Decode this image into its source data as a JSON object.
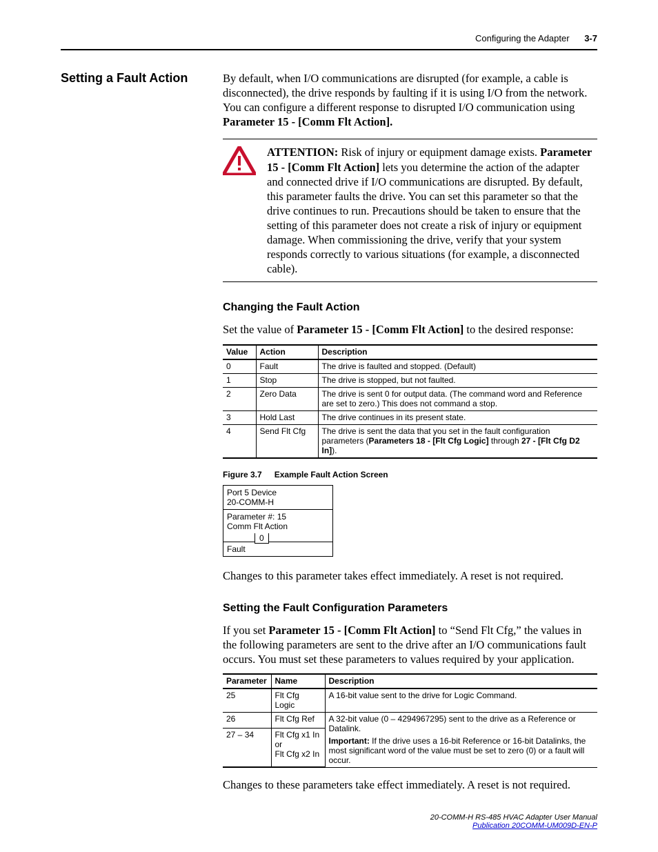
{
  "header": {
    "chapter": "Configuring the Adapter",
    "page": "3-7"
  },
  "section": {
    "title": "Setting a Fault Action",
    "intro_pre": "By default, when I/O communications are disrupted (for example, a cable is disconnected), the drive responds by faulting if it is using I/O from the network. You can configure a different response to disrupted I/O communication using ",
    "intro_bold": "Parameter 15 - [Comm Flt Action]."
  },
  "attention": {
    "label": "ATTENTION:",
    "pre": " Risk of injury or equipment damage exists. ",
    "bold": "Parameter 15 - [Comm Flt Action]",
    "post": " lets you determine the action of the adapter and connected drive if I/O communications are disrupted. By default, this parameter faults the drive. You can set this parameter so that the drive continues to run. Precautions should be taken to ensure that the setting of this parameter does not create a risk of injury or equipment damage. When commissioning the drive, verify that your system responds correctly to various situations (for example, a disconnected cable)."
  },
  "changing": {
    "heading": "Changing the Fault Action",
    "intro_pre": "Set the value of ",
    "intro_bold": "Parameter 15 - [Comm Flt Action]",
    "intro_post": " to the desired response:",
    "table": {
      "headers": [
        "Value",
        "Action",
        "Description"
      ],
      "rows": [
        {
          "value": "0",
          "action": "Fault",
          "desc": "The drive is faulted and stopped. (Default)"
        },
        {
          "value": "1",
          "action": "Stop",
          "desc": "The drive is stopped, but not faulted."
        },
        {
          "value": "2",
          "action": "Zero Data",
          "desc": "The drive is sent 0 for output data. (The command word and Reference are set to zero.) This does not command a stop."
        },
        {
          "value": "3",
          "action": "Hold Last",
          "desc": "The drive continues in its present state."
        },
        {
          "value": "4",
          "action": "Send Flt Cfg",
          "desc_pre": "The drive is sent the data that you set in the fault configuration parameters (",
          "desc_bold1": "Parameters 18 - [Flt Cfg Logic]",
          "desc_mid": " through ",
          "desc_bold2": "27 - [Flt Cfg D2 In]",
          "desc_post": ")."
        }
      ]
    }
  },
  "figure": {
    "label": "Figure 3.7",
    "title": "Example Fault Action Screen",
    "screen": {
      "line1": "Port 5 Device",
      "line2": "20-COMM-H",
      "line3": "Parameter #: 15",
      "line4": "Comm Flt Action",
      "value": "0",
      "line5": "Fault"
    },
    "after": "Changes to this parameter takes effect immediately. A reset is not required."
  },
  "faultcfg": {
    "heading": "Setting the Fault Configuration Parameters",
    "intro_pre": "If you set ",
    "intro_bold": "Parameter 15 - [Comm Flt Action]",
    "intro_post": " to “Send Flt Cfg,” the values in the following parameters are sent to the drive after an I/O communications fault occurs. You must set these parameters to values required by your application.",
    "table": {
      "headers": [
        "Parameter",
        "Name",
        "Description"
      ],
      "rows": [
        {
          "param": "25",
          "name": "Flt Cfg Logic",
          "desc": "A 16-bit value sent to the drive for Logic Command."
        },
        {
          "param": "26",
          "name": "Flt Cfg Ref",
          "desc_pre": "A 32-bit value (0 – 4294967295) sent to the drive as a Reference or Datalink.",
          "imp_label": "Important:",
          "imp_text": " If the drive uses a 16-bit Reference or 16-bit Datalinks, the most significant word of the value must be set to zero (0) or a fault will occur."
        },
        {
          "param": "27 – 34",
          "name": "Flt Cfg x1 In\nor\nFlt Cfg x2 In"
        }
      ]
    },
    "after": "Changes to these parameters take effect immediately. A reset is not required."
  },
  "footer": {
    "manual": "20-COMM-H RS-485 HVAC Adapter User Manual",
    "pub": "Publication 20COMM-UM009D-EN-P"
  },
  "chart_data": [
    {
      "type": "table",
      "title": "Parameter 15 - Comm Flt Action values",
      "columns": [
        "Value",
        "Action",
        "Description"
      ],
      "rows": [
        [
          "0",
          "Fault",
          "The drive is faulted and stopped. (Default)"
        ],
        [
          "1",
          "Stop",
          "The drive is stopped, but not faulted."
        ],
        [
          "2",
          "Zero Data",
          "The drive is sent 0 for output data. (The command word and Reference are set to zero.) This does not command a stop."
        ],
        [
          "3",
          "Hold Last",
          "The drive continues in its present state."
        ],
        [
          "4",
          "Send Flt Cfg",
          "The drive is sent the data that you set in the fault configuration parameters (Parameters 18 - [Flt Cfg Logic] through 27 - [Flt Cfg D2 In])."
        ]
      ]
    },
    {
      "type": "table",
      "title": "Fault Configuration Parameters",
      "columns": [
        "Parameter",
        "Name",
        "Description"
      ],
      "rows": [
        [
          "25",
          "Flt Cfg Logic",
          "A 16-bit value sent to the drive for Logic Command."
        ],
        [
          "26",
          "Flt Cfg Ref",
          "A 32-bit value (0 – 4294967295) sent to the drive as a Reference or Datalink."
        ],
        [
          "27 – 34",
          "Flt Cfg x1 In or Flt Cfg x2 In",
          "Important: If the drive uses a 16-bit Reference or 16-bit Datalinks, the most significant word of the value must be set to zero (0) or a fault will occur."
        ]
      ]
    }
  ]
}
